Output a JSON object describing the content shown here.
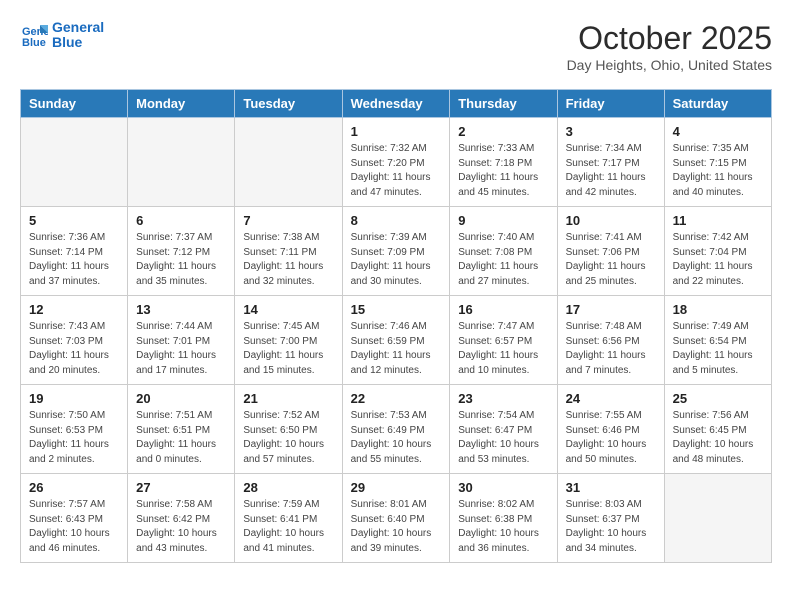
{
  "header": {
    "logo_line1": "General",
    "logo_line2": "Blue",
    "month_title": "October 2025",
    "subtitle": "Day Heights, Ohio, United States"
  },
  "days_of_week": [
    "Sunday",
    "Monday",
    "Tuesday",
    "Wednesday",
    "Thursday",
    "Friday",
    "Saturday"
  ],
  "weeks": [
    [
      {
        "day": "",
        "detail": ""
      },
      {
        "day": "",
        "detail": ""
      },
      {
        "day": "",
        "detail": ""
      },
      {
        "day": "1",
        "detail": "Sunrise: 7:32 AM\nSunset: 7:20 PM\nDaylight: 11 hours\nand 47 minutes."
      },
      {
        "day": "2",
        "detail": "Sunrise: 7:33 AM\nSunset: 7:18 PM\nDaylight: 11 hours\nand 45 minutes."
      },
      {
        "day": "3",
        "detail": "Sunrise: 7:34 AM\nSunset: 7:17 PM\nDaylight: 11 hours\nand 42 minutes."
      },
      {
        "day": "4",
        "detail": "Sunrise: 7:35 AM\nSunset: 7:15 PM\nDaylight: 11 hours\nand 40 minutes."
      }
    ],
    [
      {
        "day": "5",
        "detail": "Sunrise: 7:36 AM\nSunset: 7:14 PM\nDaylight: 11 hours\nand 37 minutes."
      },
      {
        "day": "6",
        "detail": "Sunrise: 7:37 AM\nSunset: 7:12 PM\nDaylight: 11 hours\nand 35 minutes."
      },
      {
        "day": "7",
        "detail": "Sunrise: 7:38 AM\nSunset: 7:11 PM\nDaylight: 11 hours\nand 32 minutes."
      },
      {
        "day": "8",
        "detail": "Sunrise: 7:39 AM\nSunset: 7:09 PM\nDaylight: 11 hours\nand 30 minutes."
      },
      {
        "day": "9",
        "detail": "Sunrise: 7:40 AM\nSunset: 7:08 PM\nDaylight: 11 hours\nand 27 minutes."
      },
      {
        "day": "10",
        "detail": "Sunrise: 7:41 AM\nSunset: 7:06 PM\nDaylight: 11 hours\nand 25 minutes."
      },
      {
        "day": "11",
        "detail": "Sunrise: 7:42 AM\nSunset: 7:04 PM\nDaylight: 11 hours\nand 22 minutes."
      }
    ],
    [
      {
        "day": "12",
        "detail": "Sunrise: 7:43 AM\nSunset: 7:03 PM\nDaylight: 11 hours\nand 20 minutes."
      },
      {
        "day": "13",
        "detail": "Sunrise: 7:44 AM\nSunset: 7:01 PM\nDaylight: 11 hours\nand 17 minutes."
      },
      {
        "day": "14",
        "detail": "Sunrise: 7:45 AM\nSunset: 7:00 PM\nDaylight: 11 hours\nand 15 minutes."
      },
      {
        "day": "15",
        "detail": "Sunrise: 7:46 AM\nSunset: 6:59 PM\nDaylight: 11 hours\nand 12 minutes."
      },
      {
        "day": "16",
        "detail": "Sunrise: 7:47 AM\nSunset: 6:57 PM\nDaylight: 11 hours\nand 10 minutes."
      },
      {
        "day": "17",
        "detail": "Sunrise: 7:48 AM\nSunset: 6:56 PM\nDaylight: 11 hours\nand 7 minutes."
      },
      {
        "day": "18",
        "detail": "Sunrise: 7:49 AM\nSunset: 6:54 PM\nDaylight: 11 hours\nand 5 minutes."
      }
    ],
    [
      {
        "day": "19",
        "detail": "Sunrise: 7:50 AM\nSunset: 6:53 PM\nDaylight: 11 hours\nand 2 minutes."
      },
      {
        "day": "20",
        "detail": "Sunrise: 7:51 AM\nSunset: 6:51 PM\nDaylight: 11 hours\nand 0 minutes."
      },
      {
        "day": "21",
        "detail": "Sunrise: 7:52 AM\nSunset: 6:50 PM\nDaylight: 10 hours\nand 57 minutes."
      },
      {
        "day": "22",
        "detail": "Sunrise: 7:53 AM\nSunset: 6:49 PM\nDaylight: 10 hours\nand 55 minutes."
      },
      {
        "day": "23",
        "detail": "Sunrise: 7:54 AM\nSunset: 6:47 PM\nDaylight: 10 hours\nand 53 minutes."
      },
      {
        "day": "24",
        "detail": "Sunrise: 7:55 AM\nSunset: 6:46 PM\nDaylight: 10 hours\nand 50 minutes."
      },
      {
        "day": "25",
        "detail": "Sunrise: 7:56 AM\nSunset: 6:45 PM\nDaylight: 10 hours\nand 48 minutes."
      }
    ],
    [
      {
        "day": "26",
        "detail": "Sunrise: 7:57 AM\nSunset: 6:43 PM\nDaylight: 10 hours\nand 46 minutes."
      },
      {
        "day": "27",
        "detail": "Sunrise: 7:58 AM\nSunset: 6:42 PM\nDaylight: 10 hours\nand 43 minutes."
      },
      {
        "day": "28",
        "detail": "Sunrise: 7:59 AM\nSunset: 6:41 PM\nDaylight: 10 hours\nand 41 minutes."
      },
      {
        "day": "29",
        "detail": "Sunrise: 8:01 AM\nSunset: 6:40 PM\nDaylight: 10 hours\nand 39 minutes."
      },
      {
        "day": "30",
        "detail": "Sunrise: 8:02 AM\nSunset: 6:38 PM\nDaylight: 10 hours\nand 36 minutes."
      },
      {
        "day": "31",
        "detail": "Sunrise: 8:03 AM\nSunset: 6:37 PM\nDaylight: 10 hours\nand 34 minutes."
      },
      {
        "day": "",
        "detail": ""
      }
    ]
  ]
}
